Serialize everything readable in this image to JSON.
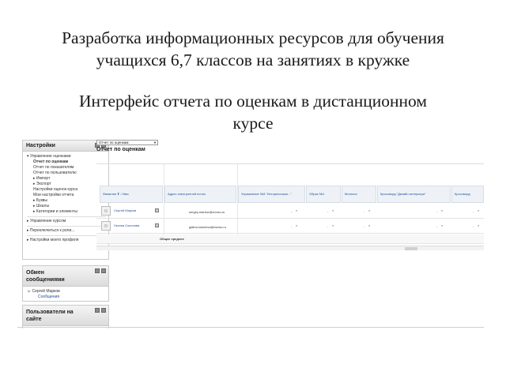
{
  "slide": {
    "title_line1": "Разработка информационных ресурсов для обучения",
    "title_line2": "учащихся 6,7 классов на занятиях в кружке",
    "subtitle_line1": "Интерфейс отчета по оценкам в дистанционном",
    "subtitle_line2": "курсе"
  },
  "settings_block": {
    "title": "Настройки",
    "items": [
      {
        "label": "▾ Управление оценками",
        "level": 0
      },
      {
        "label": "Отчет по оценкам",
        "level": 1,
        "selected": true
      },
      {
        "label": "Отчет по показателям",
        "level": 1
      },
      {
        "label": "Отчет по пользователю",
        "level": 1
      },
      {
        "label": "▸ Импорт",
        "level": 1
      },
      {
        "label": "▸ Экспорт",
        "level": 1
      },
      {
        "label": "Настройки оценок курса",
        "level": 1
      },
      {
        "label": "Мои настройки отчета",
        "level": 1
      },
      {
        "label": "▸ Буквы",
        "level": 1
      },
      {
        "label": "▸ Шкалы",
        "level": 1
      },
      {
        "label": "▸ Категории и элементы",
        "level": 1
      }
    ],
    "footer_items": [
      "▸ Управление курсом",
      "▸ Переключиться к роли...",
      "▸ Настройки моего профиля"
    ]
  },
  "messages_block": {
    "title_line1": "Обмен",
    "title_line2": "сообщениями",
    "user": "Сергей Марков",
    "link": "Сообщения"
  },
  "online_block": {
    "title_line1": "Пользователи на",
    "title_line2": "сайте"
  },
  "report": {
    "view_select": "Отчет по оценкам",
    "heading": "Отчет по оценкам",
    "col_name": "Фамилия ⬆ / Имя",
    "col_email": "Адрес электронной почты",
    "grade_columns": [
      "Упражнение №3 \"Историческая...\"",
      "Образ №1",
      "Монолог",
      "Кроссворд \"Дизайн интерьера\"",
      "Кроссворд"
    ],
    "students": [
      {
        "name": "Сергей Марков",
        "email": "sergey.markov@novsu.ru",
        "grades": [
          "-",
          "-",
          "-",
          "-",
          "-"
        ]
      },
      {
        "name": "Галина Соколова",
        "email": "galina.sokolova@novsu.ru",
        "grades": [
          "-",
          "-",
          "-",
          "-",
          "-"
        ]
      }
    ],
    "overall_average": "Общее среднее"
  }
}
